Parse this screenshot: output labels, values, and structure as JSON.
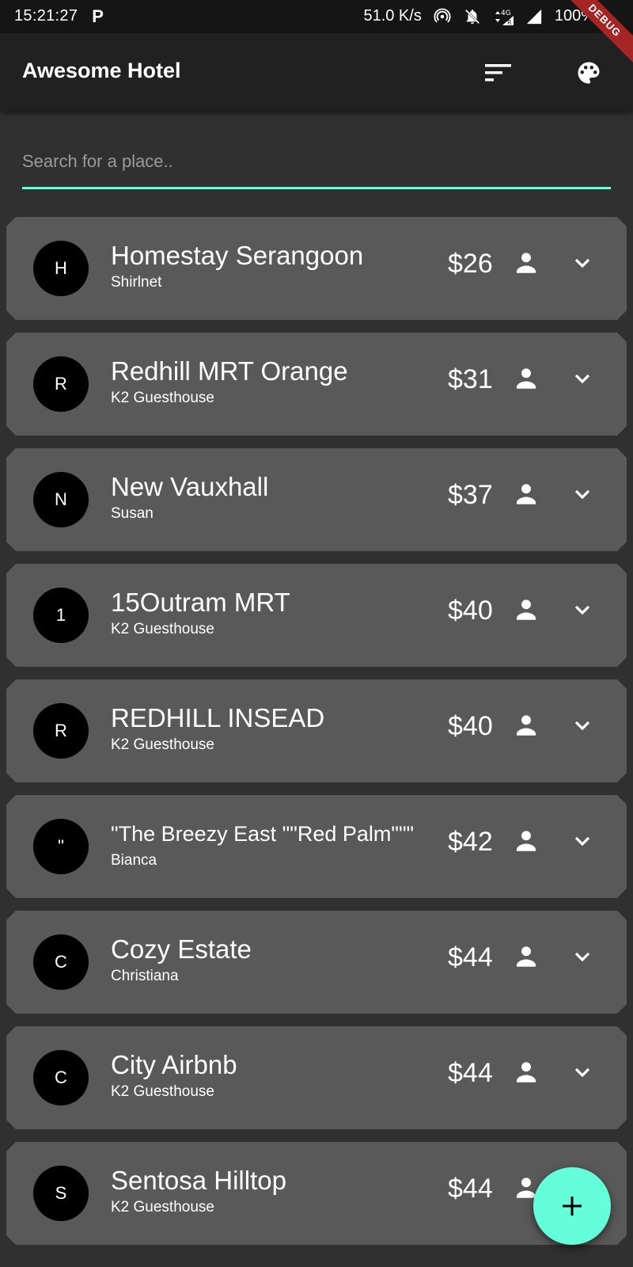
{
  "status_bar": {
    "time": "15:21:27",
    "app_indicator": "P",
    "net_speed": "51.0 K/s",
    "battery": "100%",
    "network_type": "4G",
    "debug_label": "DEBUG"
  },
  "app_bar": {
    "title": "Awesome Hotel",
    "actions": [
      "sort-icon",
      "palette-icon"
    ]
  },
  "search": {
    "placeholder": "Search for a place..",
    "value": "",
    "accent_color": "#64ffda"
  },
  "listings": [
    {
      "initial": "H",
      "title": "Homestay Serangoon",
      "host": "Shirlnet",
      "price": "$26"
    },
    {
      "initial": "R",
      "title": "Redhill MRT Orange",
      "host": "K2 Guesthouse",
      "price": "$31"
    },
    {
      "initial": "N",
      "title": "New Vauxhall",
      "host": "Susan",
      "price": "$37"
    },
    {
      "initial": "1",
      "title": "15Outram MRT",
      "host": "K2 Guesthouse",
      "price": "$40"
    },
    {
      "initial": "R",
      "title": "REDHILL INSEAD",
      "host": "K2 Guesthouse",
      "price": "$40"
    },
    {
      "initial": "\"",
      "title": "\"The Breezy East \"\"Red Palm\"\"\"",
      "host": "Bianca",
      "price": "$42"
    },
    {
      "initial": "C",
      "title": "Cozy Estate",
      "host": "Christiana",
      "price": "$44"
    },
    {
      "initial": "C",
      "title": "City Airbnb",
      "host": "K2 Guesthouse",
      "price": "$44"
    },
    {
      "initial": "S",
      "title": "Sentosa Hilltop",
      "host": "K2 Guesthouse",
      "price": "$44"
    }
  ],
  "fab": {
    "icon": "add-icon"
  },
  "colors": {
    "background": "#303030",
    "app_bar": "#212121",
    "card": "#595959",
    "accent": "#64ffda"
  }
}
